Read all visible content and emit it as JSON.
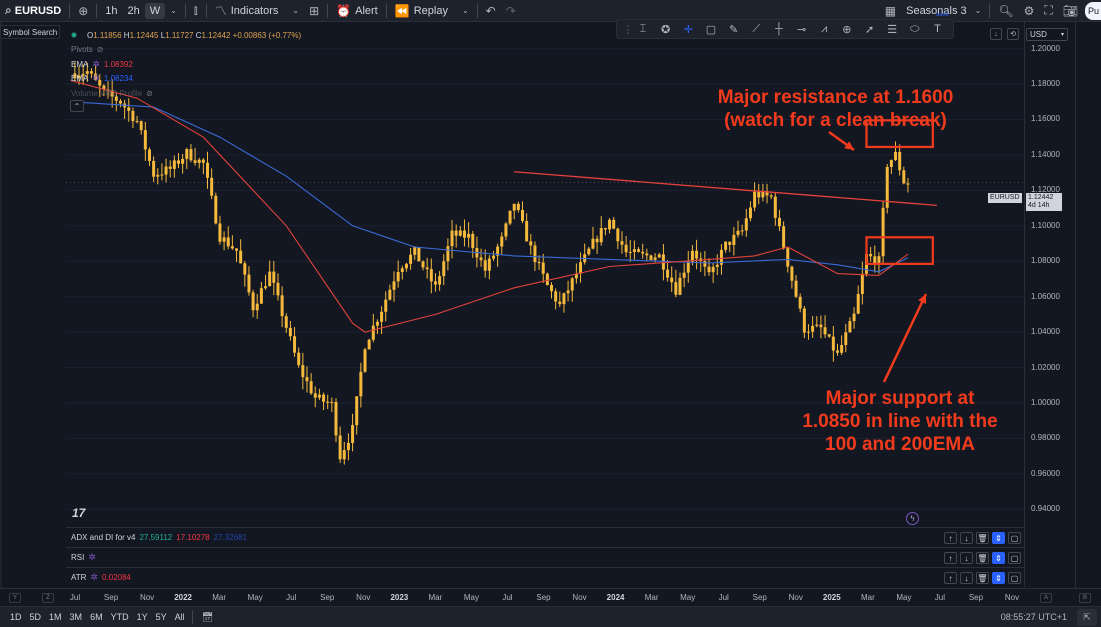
{
  "toolbar": {
    "symbol": "EURUSD",
    "intervals": [
      "1h",
      "2h",
      "W"
    ],
    "active_interval": "W",
    "indicators_label": "Indicators",
    "alert_label": "Alert",
    "replay_label": "Replay",
    "seasonals_label": "Seasonals 3",
    "seasonals_sub": "save",
    "publish_label": "Pu"
  },
  "symbol_search_label": "Symbol Search",
  "legend": {
    "ohlc": {
      "o": "1.11856",
      "h": "1.12445",
      "l": "1.11727",
      "c": "1.12442",
      "change": "+0.00863 (+0.77%)"
    },
    "pivots_label": "Pivots",
    "ema1": {
      "label": "EMA",
      "value": "1.08392"
    },
    "ema2": {
      "label": "EMA",
      "value": "1.08234"
    },
    "profile_label": "Volume VRO Profile"
  },
  "price_axis": {
    "currency": "USD",
    "ticks": [
      "1.20000",
      "1.18000",
      "1.16000",
      "1.14000",
      "1.12000",
      "1.10000",
      "1.08000",
      "1.06000",
      "1.04000",
      "1.02000",
      "1.00000",
      "0.98000",
      "0.96000",
      "0.94000"
    ],
    "current_symbol": "EURUSD",
    "current_price": "1.12442",
    "countdown": "4d 14h"
  },
  "annotations": {
    "resistance_line1": "Major resistance at 1.1600",
    "resistance_line2": "(watch for a clean break)",
    "support_line1": "Major support at",
    "support_line2": "1.0850 in line with the",
    "support_line3": "100 and 200EMA"
  },
  "panes": {
    "adx": {
      "label": "ADX and DI for v4",
      "v1": "27.59112",
      "v2": "17.10278",
      "v3": "27.32681"
    },
    "rsi": {
      "label": "RSI"
    },
    "atr": {
      "label": "ATR",
      "value": "0.02084"
    }
  },
  "time_axis": {
    "ticks": [
      {
        "label": "Jul",
        "year": false
      },
      {
        "label": "Sep",
        "year": false
      },
      {
        "label": "Nov",
        "year": false
      },
      {
        "label": "2022",
        "year": true
      },
      {
        "label": "Mar",
        "year": false
      },
      {
        "label": "May",
        "year": false
      },
      {
        "label": "Jul",
        "year": false
      },
      {
        "label": "Sep",
        "year": false
      },
      {
        "label": "Nov",
        "year": false
      },
      {
        "label": "2023",
        "year": true
      },
      {
        "label": "Mar",
        "year": false
      },
      {
        "label": "May",
        "year": false
      },
      {
        "label": "Jul",
        "year": false
      },
      {
        "label": "Sep",
        "year": false
      },
      {
        "label": "Nov",
        "year": false
      },
      {
        "label": "2024",
        "year": true
      },
      {
        "label": "Mar",
        "year": false
      },
      {
        "label": "May",
        "year": false
      },
      {
        "label": "Jul",
        "year": false
      },
      {
        "label": "Sep",
        "year": false
      },
      {
        "label": "Nov",
        "year": false
      },
      {
        "label": "2025",
        "year": true
      },
      {
        "label": "Mar",
        "year": false
      },
      {
        "label": "May",
        "year": false
      },
      {
        "label": "Jul",
        "year": false
      },
      {
        "label": "Sep",
        "year": false
      },
      {
        "label": "Nov",
        "year": false
      }
    ],
    "left_markers": [
      "Y",
      "Z"
    ],
    "right_markers": [
      "A",
      "B"
    ]
  },
  "bottom": {
    "ranges": [
      "1D",
      "5D",
      "1M",
      "3M",
      "6M",
      "YTD",
      "1Y",
      "5Y",
      "All"
    ],
    "clock": "08:55:27 UTC+1"
  },
  "colors": {
    "candle": "#f5b93b",
    "ema_fast": "#e0433a",
    "ema_slow": "#3a6bd6",
    "trendline": "#e8413b",
    "annotation": "#f23a1c"
  },
  "chart_data": {
    "type": "candlestick",
    "interval": "W",
    "symbol": "EURUSD",
    "ylim": [
      0.93,
      1.215
    ],
    "x_range": [
      "2021-07",
      "2025-11"
    ],
    "close_path": [
      [
        "2021-06-28",
        1.186
      ],
      [
        "2021-07-26",
        1.187
      ],
      [
        "2021-08-23",
        1.175
      ],
      [
        "2021-09-20",
        1.17
      ],
      [
        "2021-10-18",
        1.159
      ],
      [
        "2021-11-15",
        1.129
      ],
      [
        "2021-12-13",
        1.132
      ],
      [
        "2022-01-10",
        1.141
      ],
      [
        "2022-02-07",
        1.135
      ],
      [
        "2022-03-07",
        1.094
      ],
      [
        "2022-04-04",
        1.086
      ],
      [
        "2022-05-02",
        1.054
      ],
      [
        "2022-05-30",
        1.073
      ],
      [
        "2022-06-27",
        1.043
      ],
      [
        "2022-07-18",
        1.02
      ],
      [
        "2022-08-15",
        1.003
      ],
      [
        "2022-09-12",
        0.999
      ],
      [
        "2022-09-26",
        0.97
      ],
      [
        "2022-10-17",
        0.985
      ],
      [
        "2022-11-07",
        1.033
      ],
      [
        "2022-12-05",
        1.053
      ],
      [
        "2023-01-02",
        1.076
      ],
      [
        "2023-01-30",
        1.085
      ],
      [
        "2023-03-06",
        1.065
      ],
      [
        "2023-04-03",
        1.095
      ],
      [
        "2023-05-01",
        1.094
      ],
      [
        "2023-05-29",
        1.075
      ],
      [
        "2023-06-26",
        1.092
      ],
      [
        "2023-07-17",
        1.113
      ],
      [
        "2023-08-14",
        1.087
      ],
      [
        "2023-09-11",
        1.066
      ],
      [
        "2023-10-02",
        1.055
      ],
      [
        "2023-10-30",
        1.073
      ],
      [
        "2023-11-27",
        1.09
      ],
      [
        "2023-12-25",
        1.103
      ],
      [
        "2024-01-22",
        1.085
      ],
      [
        "2024-02-19",
        1.083
      ],
      [
        "2024-03-18",
        1.083
      ],
      [
        "2024-04-15",
        1.064
      ],
      [
        "2024-05-13",
        1.087
      ],
      [
        "2024-06-10",
        1.071
      ],
      [
        "2024-07-08",
        1.089
      ],
      [
        "2024-08-05",
        1.097
      ],
      [
        "2024-08-26",
        1.118
      ],
      [
        "2024-09-23",
        1.116
      ],
      [
        "2024-10-21",
        1.079
      ],
      [
        "2024-11-18",
        1.042
      ],
      [
        "2024-12-16",
        1.042
      ],
      [
        "2025-01-13",
        1.027
      ],
      [
        "2025-02-10",
        1.049
      ],
      [
        "2025-03-03",
        1.083
      ],
      [
        "2025-03-24",
        1.08
      ],
      [
        "2025-04-07",
        1.135
      ],
      [
        "2025-04-21",
        1.14
      ],
      [
        "2025-05-05",
        1.125
      ],
      [
        "2025-05-12",
        1.124
      ]
    ],
    "ema_fast": [
      [
        "2021-06-28",
        1.182
      ],
      [
        "2021-10-18",
        1.172
      ],
      [
        "2022-02-07",
        1.15
      ],
      [
        "2022-06-27",
        1.1
      ],
      [
        "2022-10-17",
        1.045
      ],
      [
        "2022-11-07",
        1.04
      ],
      [
        "2023-03-06",
        1.05
      ],
      [
        "2023-07-17",
        1.065
      ],
      [
        "2023-12-25",
        1.077
      ],
      [
        "2024-06-10",
        1.081
      ],
      [
        "2024-08-26",
        1.083
      ],
      [
        "2024-10-21",
        1.088
      ],
      [
        "2025-01-13",
        1.073
      ],
      [
        "2025-03-24",
        1.072
      ],
      [
        "2025-05-12",
        1.084
      ]
    ],
    "ema_slow": [
      [
        "2021-06-28",
        1.17
      ],
      [
        "2021-11-15",
        1.167
      ],
      [
        "2022-03-07",
        1.15
      ],
      [
        "2022-06-27",
        1.128
      ],
      [
        "2022-10-17",
        1.1
      ],
      [
        "2023-01-30",
        1.088
      ],
      [
        "2023-07-17",
        1.083
      ],
      [
        "2023-12-25",
        1.081
      ],
      [
        "2024-06-10",
        1.079
      ],
      [
        "2024-10-21",
        1.081
      ],
      [
        "2025-01-13",
        1.078
      ],
      [
        "2025-03-24",
        1.074
      ],
      [
        "2025-05-12",
        1.082
      ]
    ],
    "trendline": [
      [
        "2023-07-17",
        1.1305
      ],
      [
        "2025-06-30",
        1.1115
      ]
    ],
    "resistance_box": {
      "x": [
        "2025-03-03",
        "2025-06-23"
      ],
      "y": [
        1.1445,
        1.1595
      ]
    },
    "support_box": {
      "x": [
        "2025-03-03",
        "2025-06-23"
      ],
      "y": [
        1.0785,
        1.0935
      ]
    },
    "last_close": 1.12442
  }
}
